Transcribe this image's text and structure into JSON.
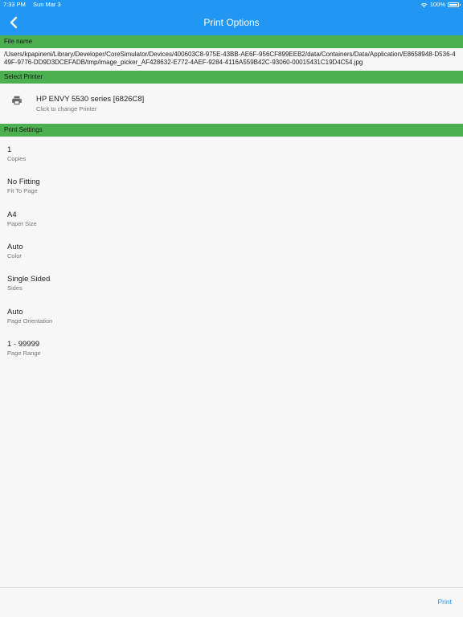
{
  "status_bar": {
    "time": "7:33 PM",
    "date": "Sun Mar 3",
    "battery": "100%"
  },
  "app_bar": {
    "title": "Print Options"
  },
  "file_section": {
    "header": "File name",
    "path": "/Users/kpapineni/Library/Developer/CoreSimulator/Devices/400603C8-975E-43BB-AE6F-956CF899EEB2/data/Containers/Data/Application/E8658948-D536-449F-9776-DD9D3DCEFADB/tmp/image_picker_AF428632-E772-4AEF-9284-4116A559B42C-93060-00015431C19D4C54.jpg"
  },
  "printer_section": {
    "header": "Select Printer",
    "printer_name": "HP ENVY 5530 series [6826C8]",
    "hint": "Click to change Printer",
    "icon": "printer-icon"
  },
  "settings_section": {
    "header": "Print Settings",
    "items": [
      {
        "value": "1",
        "label": "Copies"
      },
      {
        "value": "No Fitting",
        "label": "Fit To Page"
      },
      {
        "value": "A4",
        "label": "Paper Size"
      },
      {
        "value": "Auto",
        "label": "Color"
      },
      {
        "value": "Single Sided",
        "label": "Sides"
      },
      {
        "value": "Auto",
        "label": "Page Orientation"
      },
      {
        "value": "1 - 99999",
        "label": "Page Range"
      }
    ]
  },
  "bottom_bar": {
    "print_label": "Print"
  },
  "colors": {
    "app_bar": "#2196f3",
    "section_header": "#4caf50",
    "accent": "#2196f3"
  }
}
